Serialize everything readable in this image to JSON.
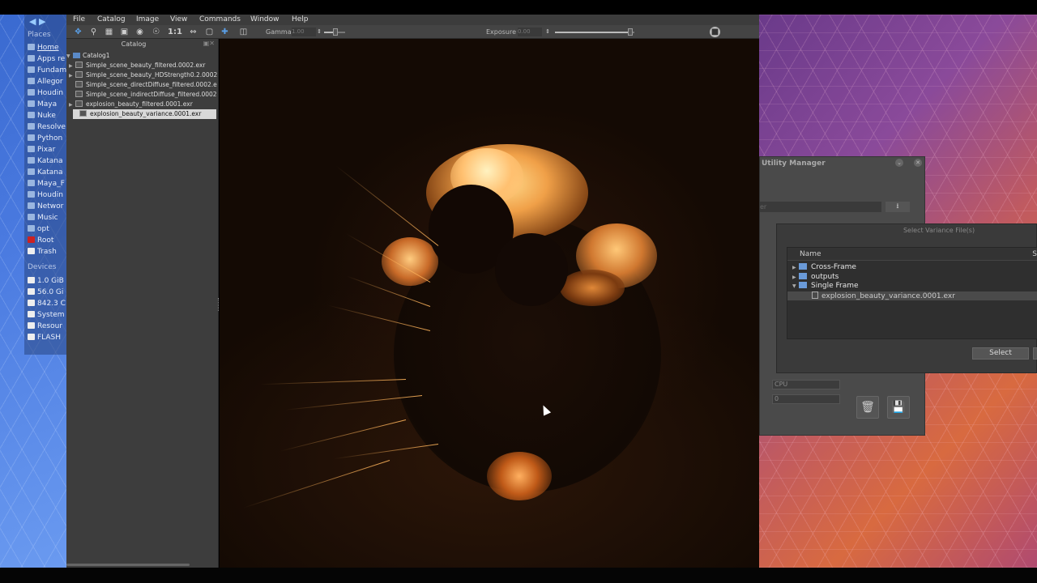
{
  "menu": {
    "items": [
      "File",
      "Catalog",
      "Image",
      "View",
      "Commands",
      "Window",
      "Help"
    ]
  },
  "toolbar": {
    "icons": [
      "move-icon",
      "zoom-icon",
      "film-icon",
      "fit-icon",
      "region-icon",
      "zoom-in-icon",
      "one-to-one",
      "flip-icon",
      "frame-icon",
      "crosshair-icon",
      "snapshot-icon"
    ],
    "one_to_one_label": "1:1",
    "gamma_label": "Gamma",
    "gamma_value": "1.00",
    "gamma_slider_fraction": 0.55,
    "exposure_label": "Exposure",
    "exposure_value": "0.00",
    "exposure_slider_fraction": 0.95
  },
  "places": {
    "heading": "Places",
    "items": [
      {
        "label": "Home",
        "icon": "folder-icon",
        "active": true
      },
      {
        "label": "Apps re",
        "icon": "folder-icon"
      },
      {
        "label": "Fundam",
        "icon": "folder-icon"
      },
      {
        "label": "Allegor",
        "icon": "folder-icon"
      },
      {
        "label": "Houdin",
        "icon": "folder-icon"
      },
      {
        "label": "Maya",
        "icon": "folder-icon"
      },
      {
        "label": "Nuke",
        "icon": "folder-icon"
      },
      {
        "label": "Resolve",
        "icon": "folder-icon"
      },
      {
        "label": "Python",
        "icon": "folder-icon"
      },
      {
        "label": "Pixar",
        "icon": "folder-icon"
      },
      {
        "label": "Katana",
        "icon": "folder-icon"
      },
      {
        "label": "Katana",
        "icon": "folder-icon"
      },
      {
        "label": "Maya_F",
        "icon": "folder-icon"
      },
      {
        "label": "Houdin",
        "icon": "folder-icon"
      },
      {
        "label": "Networ",
        "icon": "network-icon"
      },
      {
        "label": "Music",
        "icon": "folder-icon"
      },
      {
        "label": "opt",
        "icon": "folder-icon"
      },
      {
        "label": "Root",
        "icon": "root-icon"
      },
      {
        "label": "Trash",
        "icon": "trash-icon"
      }
    ],
    "devices_heading": "Devices",
    "devices": [
      {
        "label": "1.0 GiB",
        "icon": "drive-icon"
      },
      {
        "label": "56.0 Gi",
        "icon": "drive-icon"
      },
      {
        "label": "842.3 C",
        "icon": "drive-icon"
      },
      {
        "label": "System",
        "icon": "drive-icon"
      },
      {
        "label": "Resour",
        "icon": "drive-icon"
      },
      {
        "label": "FLASH",
        "icon": "usb-icon"
      }
    ]
  },
  "catalog": {
    "title": "Catalog",
    "root": "Catalog1",
    "files": [
      {
        "name": "Simple_scene_beauty_filtered.0002.exr",
        "expandable": true
      },
      {
        "name": "Simple_scene_beauty_HDStrength0.2.0002.",
        "expandable": true
      },
      {
        "name": "Simple_scene_directDiffuse_filtered.0002.ex",
        "expandable": false
      },
      {
        "name": "Simple_scene_indirectDiffuse_filtered.0002.",
        "expandable": false
      },
      {
        "name": "explosion_beauty_filtered.0001.exr",
        "expandable": true
      },
      {
        "name": "explosion_beauty_variance.0001.exr",
        "expandable": false,
        "selected": true
      }
    ]
  },
  "utility": {
    "title": "Utility Manager",
    "field_hint": "er",
    "device_select": "CPU",
    "number_value": "0"
  },
  "variance_dialog": {
    "title": "Select Variance File(s)",
    "column_name": "Name",
    "column_s": "S",
    "tree": [
      {
        "label": "Cross-Frame",
        "type": "folder",
        "expanded": false
      },
      {
        "label": "outputs",
        "type": "folder",
        "expanded": false
      },
      {
        "label": "Single Frame",
        "type": "folder",
        "expanded": true
      },
      {
        "label": "explosion_beauty_variance.0001.exr",
        "type": "file",
        "selected": true
      }
    ],
    "select_button": "Select"
  }
}
